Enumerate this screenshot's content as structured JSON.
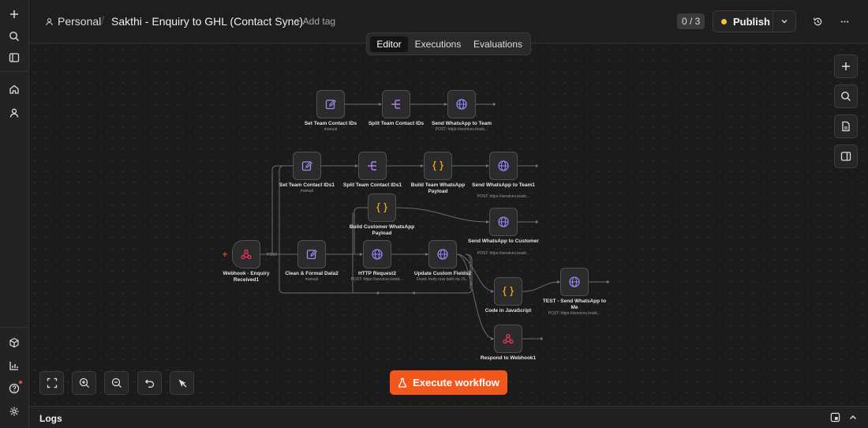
{
  "header": {
    "project": "Personal",
    "workflow_title": "Sakthi - Enquiry to GHL (Contact Sync)",
    "add_tag": "+ Add tag",
    "counter": "0 / 3",
    "publish_label": "Publish"
  },
  "tabs": [
    {
      "label": "Editor",
      "active": true
    },
    {
      "label": "Executions",
      "active": false
    },
    {
      "label": "Evaluations",
      "active": false
    }
  ],
  "nodes": {
    "set_team_ids": {
      "label": "Set Team Contact IDs",
      "sub": "manual"
    },
    "split_team_ids": {
      "label": "Split Team Contact IDs",
      "sub": ""
    },
    "send_wa_team": {
      "label": "Send WhatsApp to Team",
      "sub": "POST: https://services.leadc..."
    },
    "set_team_ids1": {
      "label": "Set Team Contact IDs1",
      "sub": "manual"
    },
    "split_team_ids1": {
      "label": "Split Team Contact IDs1",
      "sub": ""
    },
    "build_team_payload": {
      "label": "Build Team WhatsApp Payload",
      "sub": ""
    },
    "send_wa_team1": {
      "label": "Send WhatsApp to Team1",
      "sub": "POST: https://services.leadc..."
    },
    "build_customer_payload": {
      "label": "Build Customer WhatsApp Payload",
      "sub": ""
    },
    "send_wa_customer": {
      "label": "Send WhatsApp to Customer",
      "sub": "POST: https://services.leadc..."
    },
    "webhook": {
      "label": "Webhook - Enquiry Received1",
      "sub": ""
    },
    "clean_format": {
      "label": "Clean & Format Data2",
      "sub": "manual"
    },
    "http_request": {
      "label": "HTTP Request2",
      "sub": "POST: https://services.leadc..."
    },
    "update_fields": {
      "label": "Update Custom Fields2",
      "sub": "Fixed: body now built via JS..."
    },
    "code_js": {
      "label": "Code in JavaScript",
      "sub": ""
    },
    "test_send": {
      "label": "TEST - Send WhatsApp to Me",
      "sub": "POST: https://services.leadc..."
    },
    "respond": {
      "label": "Respond to Webhook1",
      "sub": ""
    }
  },
  "edge_labels": {
    "post": "POST"
  },
  "execute_label": "Execute workflow",
  "logs_label": "Logs",
  "colors": {
    "accent": "#f2581e",
    "edit_icon": "#9b8cf0",
    "split_icon": "#b07ff0",
    "code_icon": "#f5a623",
    "webhook_icon": "#e8365d",
    "globe_icon": "#8f87f1",
    "publish_dot": "#f4c531"
  }
}
